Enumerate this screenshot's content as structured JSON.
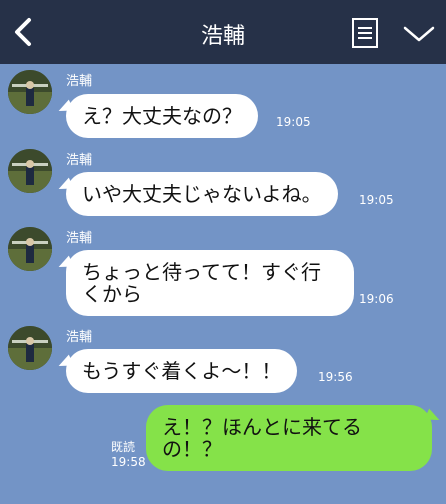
{
  "header": {
    "title": "浩輔"
  },
  "messages": [
    {
      "sender": "浩輔",
      "text": "え？大丈夫なの？",
      "time": "19:05"
    },
    {
      "sender": "浩輔",
      "text": "いや大丈夫じゃないよね。",
      "time": "19:05"
    },
    {
      "sender": "浩輔",
      "text": "ちょっと待ってて！すぐ行くから",
      "time": "19:06"
    },
    {
      "sender": "浩輔",
      "text": "もうすぐ着くよ〜！！",
      "time": "19:56"
    }
  ],
  "outgoing": {
    "text": "え！？ほんとに来てるの！？",
    "read_label": "既読",
    "time": "19:58"
  },
  "colors": {
    "background": "#7394c6",
    "header": "#263148",
    "incoming_bubble": "#ffffff",
    "outgoing_bubble": "#85e249"
  }
}
